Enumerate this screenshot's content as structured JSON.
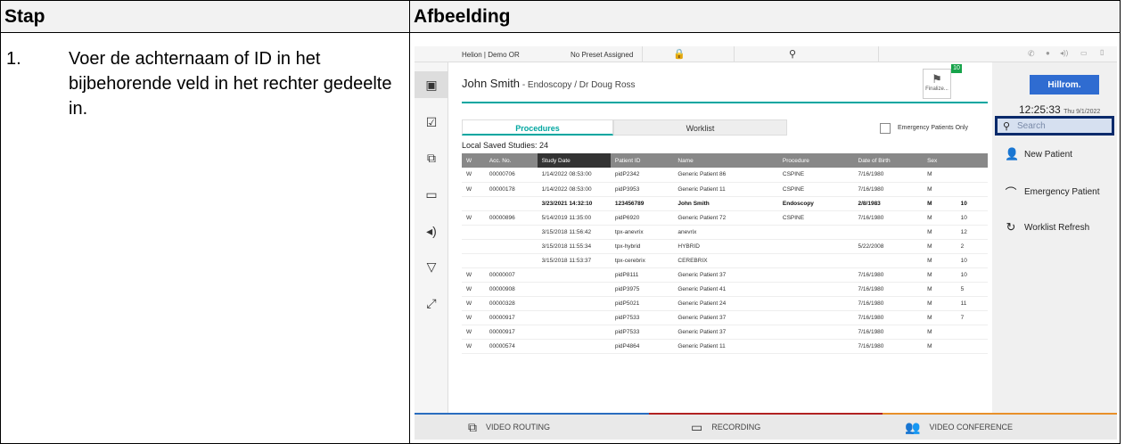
{
  "table_headers": {
    "step": "Stap",
    "image": "Afbeelding"
  },
  "step": {
    "number": "1.",
    "text": "Voer de achternaam of ID in het bijbehorende veld in het rechter gedeelte in."
  },
  "app": {
    "topbar": {
      "location": "Helion | Demo OR",
      "preset": "No Preset Assigned"
    },
    "patient": {
      "name": "John Smith",
      "detail": " - Endoscopy / Dr Doug Ross",
      "finalize_label": "Finalize...",
      "badge": "10"
    },
    "logo": "Hillrom.",
    "clock": {
      "time": "12:25:33",
      "date": "Thu 9/1/2022"
    },
    "search": {
      "placeholder": "Search"
    },
    "right_buttons": {
      "new_patient": "New Patient",
      "emergency_patient": "Emergency Patient",
      "worklist_refresh": "Worklist Refresh"
    },
    "tabs": {
      "procedures": "Procedures",
      "worklist": "Worklist"
    },
    "emergency_only": "Emergency Patients Only",
    "saved_studies": "Local Saved Studies: 24",
    "columns": [
      "W",
      "Acc. No.",
      "Study Date",
      "Patient ID",
      "Name",
      "Procedure",
      "Date of Birth",
      "Sex",
      ""
    ],
    "rows": [
      [
        "W",
        "00000706",
        "1/14/2022 08:53:00",
        "pidP2342",
        "Generic Patient 86",
        "CSPINE",
        "7/16/1980",
        "M",
        ""
      ],
      [
        "W",
        "00000178",
        "1/14/2022 08:53:00",
        "pidP3953",
        "Generic Patient 11",
        "CSPINE",
        "7/16/1980",
        "M",
        ""
      ],
      [
        "",
        "",
        "3/23/2021 14:32:10",
        "123456789",
        "John Smith",
        "Endoscopy",
        "2/8/1983",
        "M",
        "10"
      ],
      [
        "W",
        "00000896",
        "5/14/2019 11:35:00",
        "pidP6920",
        "Generic Patient 72",
        "CSPINE",
        "7/16/1980",
        "M",
        "10"
      ],
      [
        "",
        "",
        "3/15/2018 11:56:42",
        "tpx-anevrix",
        "anevrix",
        "",
        "",
        "M",
        "12"
      ],
      [
        "",
        "",
        "3/15/2018 11:55:34",
        "tpx-hybrid",
        "HYBRID",
        "",
        "5/22/2008",
        "M",
        "2"
      ],
      [
        "",
        "",
        "3/15/2018 11:53:37",
        "tpx-cerebrix",
        "CEREBRIX",
        "",
        "",
        "M",
        "10"
      ],
      [
        "W",
        "00000007",
        "",
        "pidP8111",
        "Generic Patient 37",
        "",
        "7/16/1980",
        "M",
        "10"
      ],
      [
        "W",
        "00000908",
        "",
        "pidP3975",
        "Generic Patient 41",
        "",
        "7/16/1980",
        "M",
        "5"
      ],
      [
        "W",
        "00000328",
        "",
        "pidP5021",
        "Generic Patient 24",
        "",
        "7/16/1980",
        "M",
        "11"
      ],
      [
        "W",
        "00000917",
        "",
        "pidP7533",
        "Generic Patient 37",
        "",
        "7/16/1980",
        "M",
        "7"
      ],
      [
        "W",
        "00000917",
        "",
        "pidP7533",
        "Generic Patient 37",
        "",
        "7/16/1980",
        "M",
        ""
      ],
      [
        "W",
        "00000574",
        "",
        "pidP4864",
        "Generic Patient 11",
        "",
        "7/16/1980",
        "M",
        ""
      ]
    ],
    "bottom": {
      "video_routing": "VIDEO ROUTING",
      "recording": "RECORDING",
      "video_conference": "VIDEO CONFERENCE"
    }
  },
  "colors": {
    "accent": "#00a6a0",
    "search_border": "#0a2a6b",
    "brand": "#2f6cd1"
  }
}
